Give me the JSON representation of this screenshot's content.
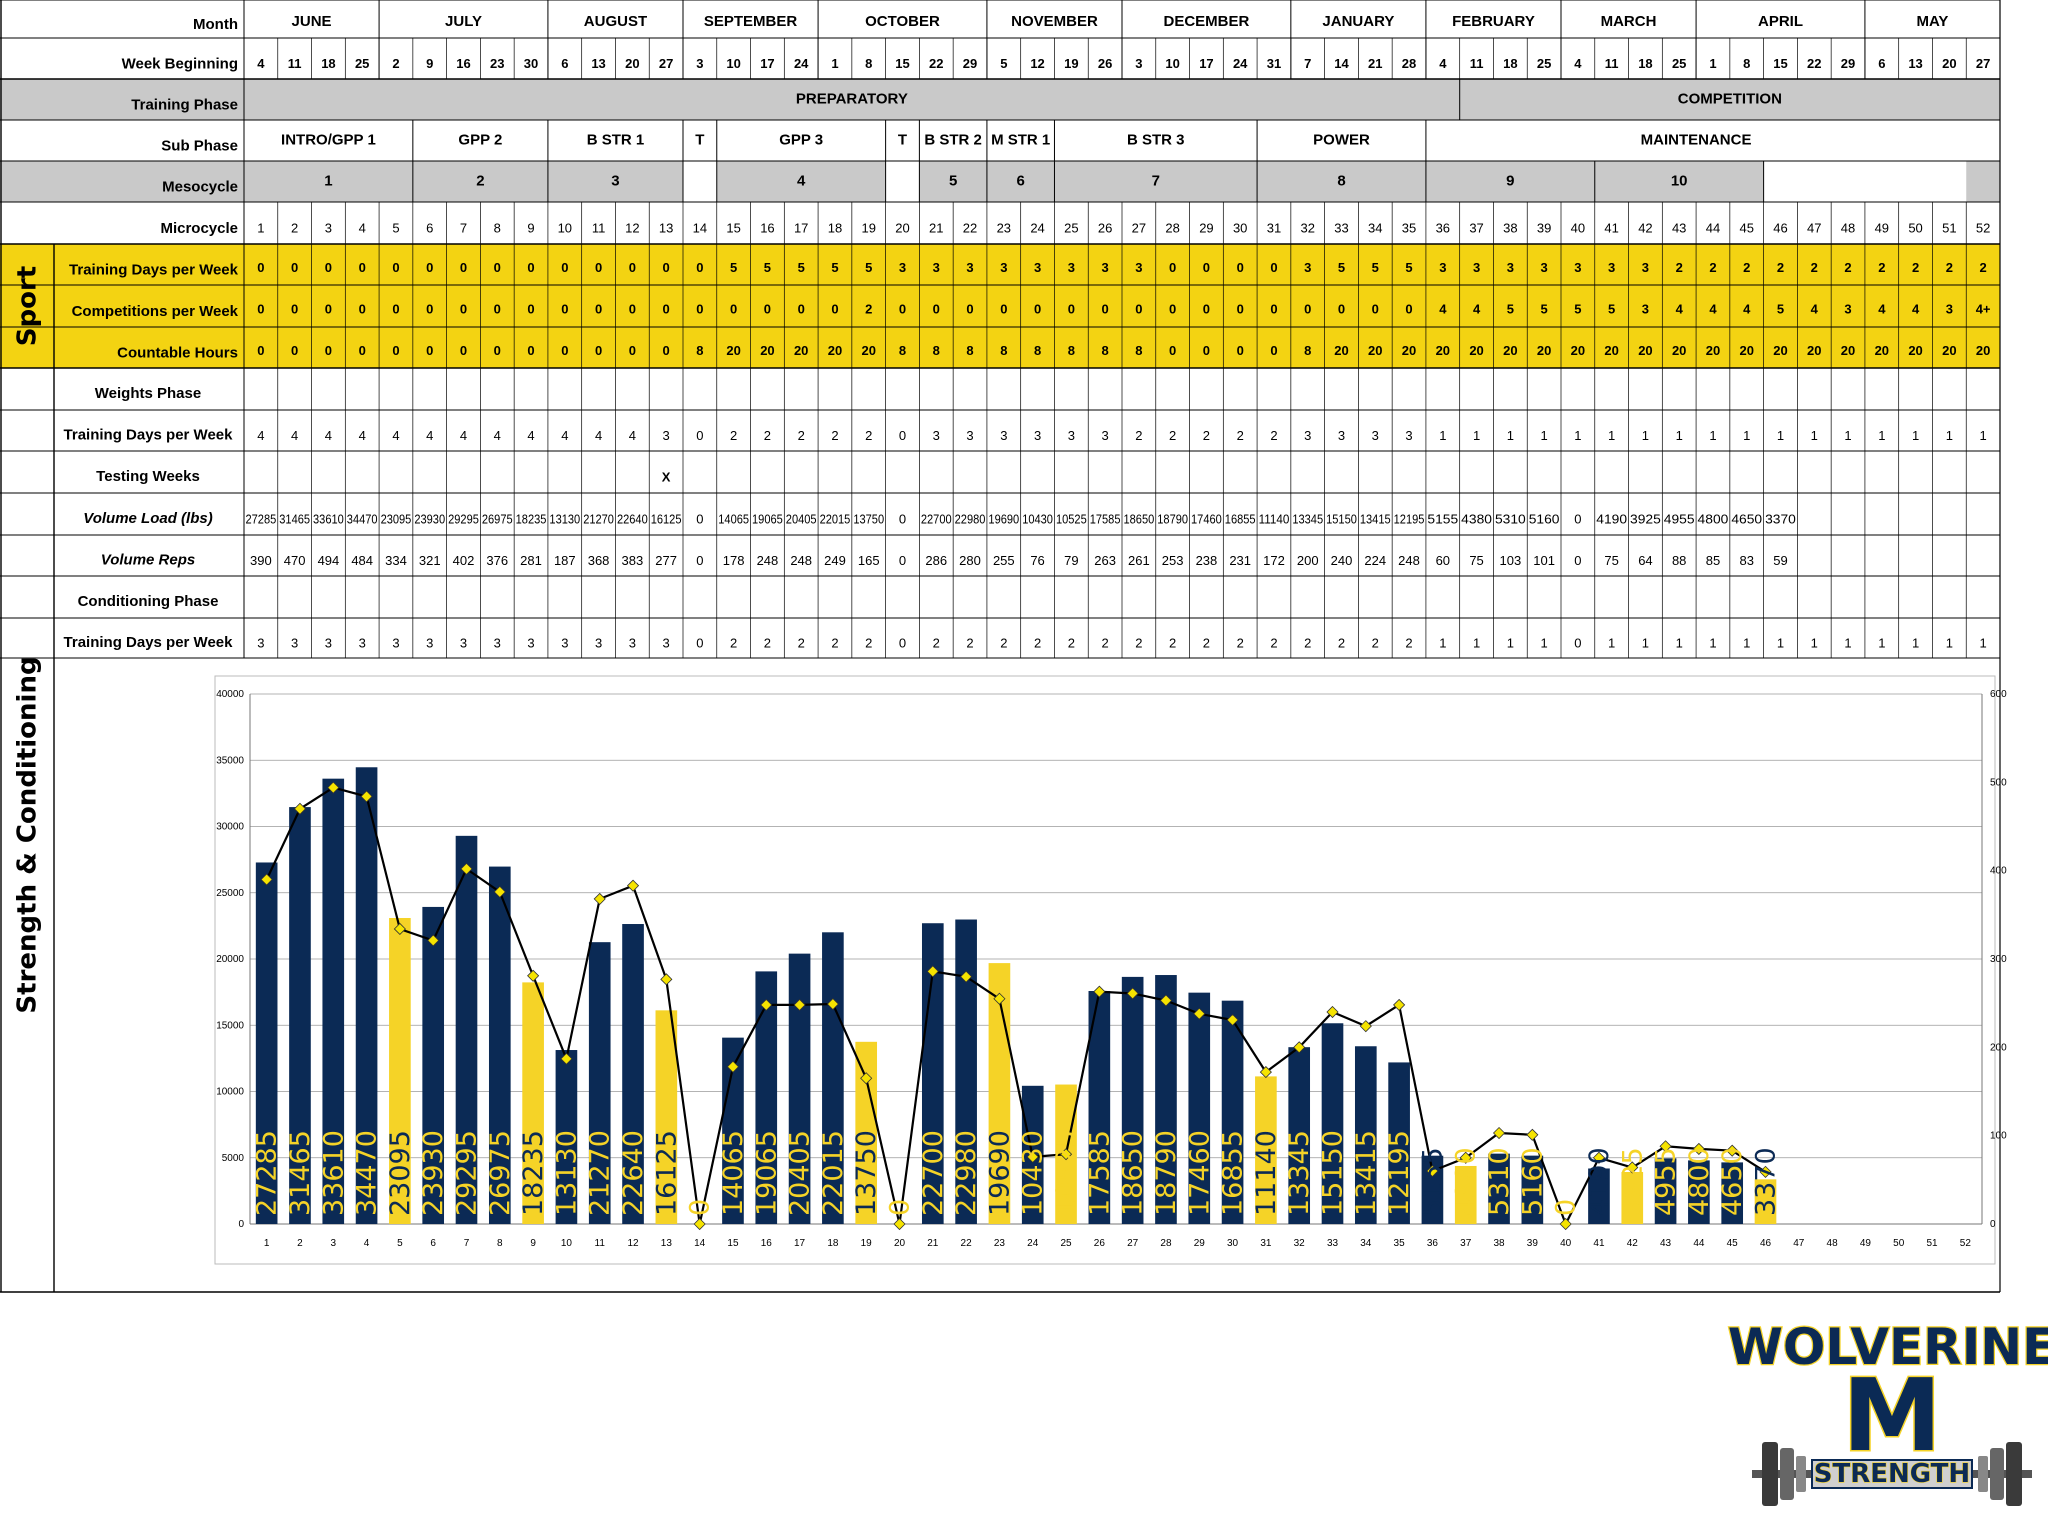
{
  "row_labels": {
    "month": "Month",
    "week_beginning": "Week Beginning",
    "training_phase": "Training Phase",
    "sub_phase": "Sub Phase",
    "mesocycle": "Mesocycle",
    "microcycle": "Microcycle",
    "sport_training_days": "Training Days per Week",
    "competitions": "Competitions per Week",
    "countable_hours": "Countable Hours",
    "weights_phase": "Weights Phase",
    "sc_training_days": "Training Days per Week",
    "testing_weeks": "Testing Weeks",
    "volume_load": "Volume Load (lbs)",
    "volume_reps": "Volume Reps",
    "conditioning_phase": "Conditioning Phase",
    "cond_training_days": "Training Days per Week"
  },
  "section_labels": {
    "sport": "Sport",
    "strength_conditioning": "Strength & Conditioning"
  },
  "months": [
    {
      "name": "JUNE",
      "weeks": 4
    },
    {
      "name": "JULY",
      "weeks": 5
    },
    {
      "name": "AUGUST",
      "weeks": 4
    },
    {
      "name": "SEPTEMBER",
      "weeks": 4
    },
    {
      "name": "OCTOBER",
      "weeks": 5
    },
    {
      "name": "NOVEMBER",
      "weeks": 4
    },
    {
      "name": "DECEMBER",
      "weeks": 5
    },
    {
      "name": "JANUARY",
      "weeks": 4
    },
    {
      "name": "FEBRUARY",
      "weeks": 4
    },
    {
      "name": "MARCH",
      "weeks": 4
    },
    {
      "name": "APRIL",
      "weeks": 5
    },
    {
      "name": "MAY",
      "weeks": 4
    }
  ],
  "week_beginning": [
    "4",
    "11",
    "18",
    "25",
    "2",
    "9",
    "16",
    "23",
    "30",
    "6",
    "13",
    "20",
    "27",
    "3",
    "10",
    "17",
    "24",
    "1",
    "8",
    "15",
    "22",
    "29",
    "5",
    "12",
    "19",
    "26",
    "3",
    "10",
    "17",
    "24",
    "31",
    "7",
    "14",
    "21",
    "28",
    "4",
    "11",
    "18",
    "25",
    "4",
    "11",
    "18",
    "25",
    "1",
    "8",
    "15",
    "22",
    "29",
    "6",
    "13",
    "20",
    "27"
  ],
  "training_phase": [
    {
      "label": "PREPARATORY",
      "span": 36
    },
    {
      "label": "COMPETITION",
      "span": 16
    }
  ],
  "sub_phase": [
    {
      "label": "INTRO/GPP 1",
      "span": 5
    },
    {
      "label": "GPP 2",
      "span": 4
    },
    {
      "label": "B STR 1",
      "span": 4
    },
    {
      "label": "T",
      "span": 1
    },
    {
      "label": "GPP 3",
      "span": 5
    },
    {
      "label": "T",
      "span": 1
    },
    {
      "label": "B STR 2",
      "span": 2
    },
    {
      "label": "M STR 1",
      "span": 2
    },
    {
      "label": "B STR 3",
      "span": 6
    },
    {
      "label": "POWER",
      "span": 5
    },
    {
      "label": "MAINTENANCE",
      "span": 16
    }
  ],
  "mesocycle": [
    {
      "label": "1",
      "span": 5
    },
    {
      "label": "2",
      "span": 4
    },
    {
      "label": "3",
      "span": 4
    },
    {
      "label": "",
      "span": 1
    },
    {
      "label": "4",
      "span": 5
    },
    {
      "label": "",
      "span": 1
    },
    {
      "label": "5",
      "span": 2
    },
    {
      "label": "6",
      "span": 2
    },
    {
      "label": "7",
      "span": 6
    },
    {
      "label": "8",
      "span": 5
    },
    {
      "label": "9",
      "span": 5
    },
    {
      "label": "10",
      "span": 5
    },
    {
      "label": "",
      "span": 6
    }
  ],
  "sport": {
    "training_days": [
      "0",
      "0",
      "0",
      "0",
      "0",
      "0",
      "0",
      "0",
      "0",
      "0",
      "0",
      "0",
      "0",
      "0",
      "5",
      "5",
      "5",
      "5",
      "5",
      "3",
      "3",
      "3",
      "3",
      "3",
      "3",
      "3",
      "3",
      "0",
      "0",
      "0",
      "0",
      "3",
      "5",
      "5",
      "5",
      "3",
      "3",
      "3",
      "3",
      "3",
      "3",
      "3",
      "2",
      "2",
      "2",
      "2",
      "2",
      "2",
      "2",
      "2",
      "2",
      "2"
    ],
    "competitions": [
      "0",
      "0",
      "0",
      "0",
      "0",
      "0",
      "0",
      "0",
      "0",
      "0",
      "0",
      "0",
      "0",
      "0",
      "0",
      "0",
      "0",
      "0",
      "2",
      "0",
      "0",
      "0",
      "0",
      "0",
      "0",
      "0",
      "0",
      "0",
      "0",
      "0",
      "0",
      "0",
      "0",
      "0",
      "0",
      "4",
      "4",
      "5",
      "5",
      "5",
      "5",
      "3",
      "4",
      "4",
      "4",
      "5",
      "4",
      "3",
      "4",
      "4",
      "3",
      "4+"
    ],
    "countable_hours": [
      "0",
      "0",
      "0",
      "0",
      "0",
      "0",
      "0",
      "0",
      "0",
      "0",
      "0",
      "0",
      "0",
      "8",
      "20",
      "20",
      "20",
      "20",
      "20",
      "8",
      "8",
      "8",
      "8",
      "8",
      "8",
      "8",
      "8",
      "0",
      "0",
      "0",
      "0",
      "8",
      "20",
      "20",
      "20",
      "20",
      "20",
      "20",
      "20",
      "20",
      "20",
      "20",
      "20",
      "20",
      "20",
      "20",
      "20",
      "20",
      "20",
      "20",
      "20",
      "20"
    ]
  },
  "sc": {
    "training_days": [
      "4",
      "4",
      "4",
      "4",
      "4",
      "4",
      "4",
      "4",
      "4",
      "4",
      "4",
      "4",
      "3",
      "0",
      "2",
      "2",
      "2",
      "2",
      "2",
      "0",
      "3",
      "3",
      "3",
      "3",
      "3",
      "3",
      "2",
      "2",
      "2",
      "2",
      "2",
      "3",
      "3",
      "3",
      "3",
      "1",
      "1",
      "1",
      "1",
      "1",
      "1",
      "1",
      "1",
      "1",
      "1",
      "1",
      "1",
      "1",
      "1",
      "1",
      "1",
      "1"
    ],
    "testing_weeks": [
      "",
      "",
      "",
      "",
      "",
      "",
      "",
      "",
      "",
      "",
      "",
      "",
      "X",
      "",
      "",
      "",
      "",
      "",
      "",
      "",
      "",
      "",
      "",
      "",
      "",
      "",
      "",
      "",
      "",
      "",
      "",
      "",
      "",
      "",
      "",
      "",
      "",
      "",
      "",
      "",
      "",
      "",
      "",
      "",
      "",
      "",
      "",
      "",
      "",
      "",
      "",
      ""
    ],
    "volume_load": [
      "27285",
      "31465",
      "33610",
      "34470",
      "23095",
      "23930",
      "29295",
      "26975",
      "18235",
      "13130",
      "21270",
      "22640",
      "16125",
      "0",
      "14065",
      "19065",
      "20405",
      "22015",
      "13750",
      "0",
      "22700",
      "22980",
      "19690",
      "10430",
      "10525",
      "17585",
      "18650",
      "18790",
      "17460",
      "16855",
      "11140",
      "13345",
      "15150",
      "13415",
      "12195",
      "5155",
      "4380",
      "5310",
      "5160",
      "0",
      "4190",
      "3925",
      "4955",
      "4800",
      "4650",
      "3370",
      "",
      "",
      "",
      "",
      "",
      ""
    ],
    "volume_reps": [
      "390",
      "470",
      "494",
      "484",
      "334",
      "321",
      "402",
      "376",
      "281",
      "187",
      "368",
      "383",
      "277",
      "0",
      "178",
      "248",
      "248",
      "249",
      "165",
      "0",
      "286",
      "280",
      "255",
      "76",
      "79",
      "263",
      "261",
      "253",
      "238",
      "231",
      "172",
      "200",
      "240",
      "224",
      "248",
      "60",
      "75",
      "103",
      "101",
      "0",
      "75",
      "64",
      "88",
      "85",
      "83",
      "59",
      "",
      "",
      "",
      "",
      "",
      ""
    ],
    "conditioning_days": [
      "3",
      "3",
      "3",
      "3",
      "3",
      "3",
      "3",
      "3",
      "3",
      "3",
      "3",
      "3",
      "3",
      "0",
      "2",
      "2",
      "2",
      "2",
      "2",
      "0",
      "2",
      "2",
      "2",
      "2",
      "2",
      "2",
      "2",
      "2",
      "2",
      "2",
      "2",
      "2",
      "2",
      "2",
      "2",
      "1",
      "1",
      "1",
      "1",
      "0",
      "1",
      "1",
      "1",
      "1",
      "1",
      "1",
      "1",
      "1",
      "1",
      "1",
      "1",
      "1"
    ]
  },
  "chart_data": {
    "type": "bar",
    "categories": [
      "1",
      "2",
      "3",
      "4",
      "5",
      "6",
      "7",
      "8",
      "9",
      "10",
      "11",
      "12",
      "13",
      "14",
      "15",
      "16",
      "17",
      "18",
      "19",
      "20",
      "21",
      "22",
      "23",
      "24",
      "25",
      "26",
      "27",
      "28",
      "29",
      "30",
      "31",
      "32",
      "33",
      "34",
      "35",
      "36",
      "37",
      "38",
      "39",
      "40",
      "41",
      "42",
      "43",
      "44",
      "45",
      "46",
      "47",
      "48",
      "49",
      "50",
      "51",
      "52"
    ],
    "series": [
      {
        "values": [
          27285,
          31465,
          33610,
          34470,
          23095,
          23930,
          29295,
          26975,
          18235,
          13130,
          21270,
          22640,
          16125,
          0,
          14065,
          19065,
          20405,
          22015,
          13750,
          0,
          22700,
          22980,
          19690,
          10430,
          10525,
          17585,
          18650,
          18790,
          17460,
          16855,
          11140,
          13345,
          15150,
          13415,
          12195,
          5155,
          4380,
          5310,
          5160,
          0,
          4190,
          3925,
          4955,
          4800,
          4650,
          3370,
          null,
          null,
          null,
          null,
          null,
          null
        ]
      },
      {
        "type": "line",
        "axis": "right",
        "values": [
          390,
          470,
          494,
          484,
          334,
          321,
          402,
          376,
          281,
          187,
          368,
          383,
          277,
          0,
          178,
          248,
          248,
          249,
          165,
          0,
          286,
          280,
          255,
          76,
          79,
          263,
          261,
          253,
          238,
          231,
          172,
          200,
          240,
          224,
          248,
          60,
          75,
          103,
          101,
          0,
          75,
          64,
          88,
          85,
          83,
          59,
          null,
          null,
          null,
          null,
          null,
          null
        ]
      }
    ],
    "bar_colors": [
      "navy",
      "navy",
      "navy",
      "navy",
      "gold",
      "navy",
      "navy",
      "navy",
      "gold",
      "navy",
      "navy",
      "navy",
      "gold",
      "gold",
      "navy",
      "navy",
      "navy",
      "navy",
      "gold",
      "gold",
      "navy",
      "navy",
      "gold",
      "navy",
      "gold",
      "navy",
      "navy",
      "navy",
      "navy",
      "navy",
      "gold",
      "navy",
      "navy",
      "navy",
      "navy",
      "navy",
      "gold",
      "navy",
      "navy",
      "gold",
      "navy",
      "gold",
      "navy",
      "navy",
      "navy",
      "gold"
    ],
    "label_colors": [
      "gold",
      "gold",
      "gold",
      "gold",
      "navy",
      "gold",
      "gold",
      "gold",
      "navy",
      "gold",
      "gold",
      "gold",
      "navy",
      "gold",
      "gold",
      "gold",
      "gold",
      "gold",
      "navy",
      "gold",
      "gold",
      "gold",
      "navy",
      "gold",
      "gold",
      "gold",
      "gold",
      "gold",
      "gold",
      "gold",
      "navy",
      "gold",
      "gold",
      "gold",
      "gold",
      "navy",
      "gold",
      "gold",
      "gold",
      "gold",
      "navy",
      "gold",
      "gold",
      "gold",
      "gold",
      "navy"
    ],
    "ylim_left": [
      0,
      40000
    ],
    "yticks_left": [
      "0",
      "5000",
      "10000",
      "15000",
      "20000",
      "25000",
      "30000",
      "35000",
      "40000"
    ],
    "ylim_right": [
      0,
      600
    ],
    "yticks_right": [
      "0",
      "100",
      "200",
      "300",
      "400",
      "500",
      "600"
    ],
    "grid": true
  },
  "colors": {
    "navy": "#0b2a55",
    "gold": "#f5d327",
    "sport_band": "#f3d312",
    "phase_gray": "#c9c9c9",
    "line": "#000000",
    "marker": "#f5e300"
  },
  "logo": {
    "top": "WOLVERINE",
    "letter": "M",
    "bottom": "STRENGTH"
  }
}
